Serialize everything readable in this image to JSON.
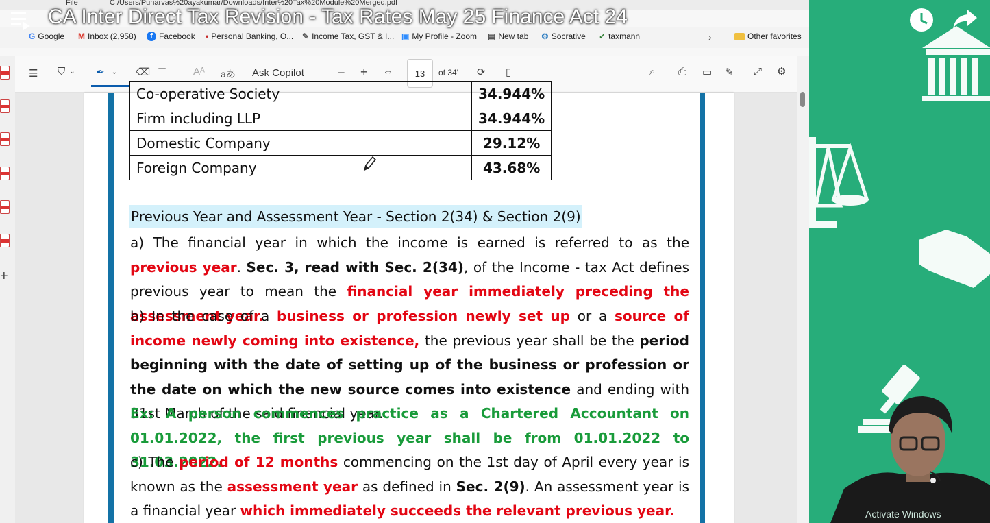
{
  "video": {
    "title": "CA Inter Direct Tax Revision - Tax Rates May 25 Finance Act 24"
  },
  "browser": {
    "file_label": "File",
    "url": "C:/Users/Punarvas%20ayakumar/Downloads/Inter%20Tax%20Module%20Merged.pdf",
    "bookmarks": [
      {
        "label": "Google",
        "icon": "G"
      },
      {
        "label": "Inbox (2,958)",
        "icon": "M"
      },
      {
        "label": "Facebook",
        "icon": "f"
      },
      {
        "label": "Personal Banking, O...",
        "icon": "•"
      },
      {
        "label": "Income Tax, GST & I...",
        "icon": "✎"
      },
      {
        "label": "My Profile - Zoom",
        "icon": "▣"
      },
      {
        "label": "New tab",
        "icon": "▤"
      },
      {
        "label": "Socrative",
        "icon": "⚙"
      },
      {
        "label": "taxmann",
        "icon": "✓"
      }
    ],
    "other_favorites": "Other favorites"
  },
  "pdf_toolbar": {
    "ask_copilot": "Ask Copilot",
    "minus": "−",
    "plus": "+",
    "page_number": "13",
    "page_total": "of 34'",
    "read_aloud": "aあ"
  },
  "document": {
    "table_rows": [
      {
        "name": "Co-operative Society",
        "rate": "34.944%"
      },
      {
        "name": "Firm including LLP",
        "rate": "34.944%"
      },
      {
        "name": "Domestic Company",
        "rate": "29.12%"
      },
      {
        "name": "Foreign Company",
        "rate": "43.68%"
      }
    ],
    "heading": "Previous Year and Assessment Year - Section 2(34) & Section 2(9)",
    "para_a": [
      {
        "t": "a) The financial year in which the income is earned is referred to as the ",
        "s": ""
      },
      {
        "t": "previous year",
        "s": "r"
      },
      {
        "t": ". ",
        "s": ""
      },
      {
        "t": "Sec. 3, read with Sec. 2(34)",
        "s": "b"
      },
      {
        "t": ", of the Income - tax Act defines previous year to mean the ",
        "s": ""
      },
      {
        "t": "financial year immediately preceding the assessment year.",
        "s": "r"
      }
    ],
    "para_b": [
      {
        "t": "b) In the case of a ",
        "s": ""
      },
      {
        "t": "business or profession newly set up",
        "s": "r"
      },
      {
        "t": " or a ",
        "s": ""
      },
      {
        "t": "source of income newly coming into existence,",
        "s": "r"
      },
      {
        "t": " the previous year shall be the ",
        "s": ""
      },
      {
        "t": "period beginning with the date of setting up of the business or profession or the date on which the new source comes into existence",
        "s": "b"
      },
      {
        "t": " and ending with 31st March of the said financial year.",
        "s": ""
      }
    ],
    "example": "Ex: A person commences practice as a Chartered Accountant on 01.01.2022, the first previous year shall be from 01.01.2022 to 31.03.2022.",
    "para_c": [
      {
        "t": "c) The ",
        "s": ""
      },
      {
        "t": "period of 12 months",
        "s": "r"
      },
      {
        "t": " commencing on the 1st day of April every year is known as the ",
        "s": ""
      },
      {
        "t": "assessment year",
        "s": "r"
      },
      {
        "t": " as defined in ",
        "s": ""
      },
      {
        "t": "Sec. 2(9)",
        "s": "b"
      },
      {
        "t": ". An assessment year is a financial year ",
        "s": ""
      },
      {
        "t": "which immediately succeeds the relevant previous year.",
        "s": "r"
      }
    ]
  },
  "watermark": "Activate Windows",
  "colors": {
    "accent_red": "#e30613",
    "accent_green": "#199b3a",
    "heading_highlight": "#d4f1fb",
    "frame_blue": "#1372a6",
    "panel_green": "#27ad7a"
  }
}
